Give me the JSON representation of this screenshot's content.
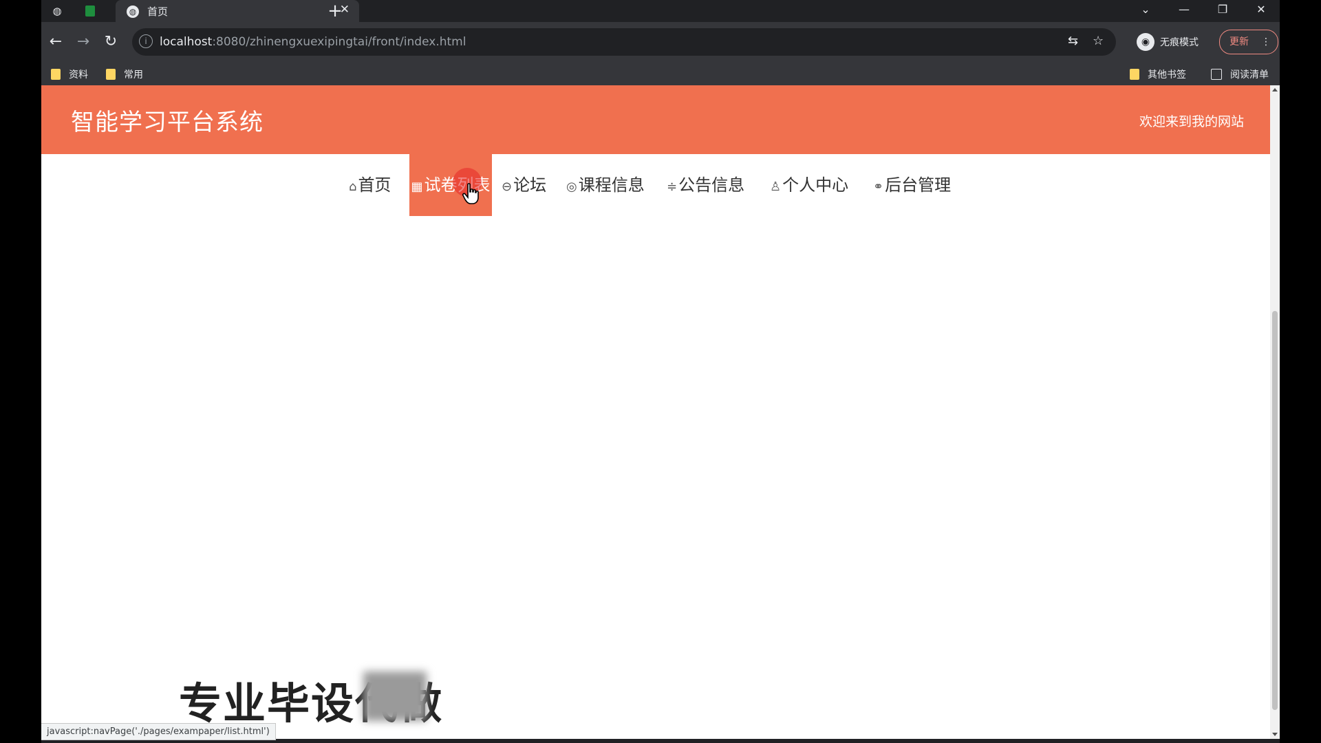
{
  "browser": {
    "tab": {
      "title": "首页"
    },
    "address_bar": {
      "host": "localhost",
      "path": ":8080/zhinengxuexipingtai/front/index.html"
    },
    "profile": {
      "label": "无痕模式"
    },
    "update_button": {
      "label": "更新"
    },
    "bookmarks": {
      "left": [
        {
          "label": "资料"
        },
        {
          "label": "常用"
        }
      ],
      "other_label": "其他书签",
      "reading_list_label": "阅读清单"
    },
    "status_url": "javascript:navPage('./pages/exampaper/list.html')",
    "icons": {
      "favicon": "globe-icon",
      "back": "arrow-left-icon",
      "forward": "arrow-right-icon",
      "reload": "reload-icon",
      "site_info": "info-icon",
      "translate": "translate-icon",
      "bookmark": "star-icon",
      "tab_close": "close-icon",
      "new_tab": "plus-icon"
    }
  },
  "site": {
    "title": "智能学习平台系统",
    "welcome": "欢迎来到我的网站",
    "theme_color": "#f0704f",
    "nav": [
      {
        "label": "首页",
        "icon": "home-icon"
      },
      {
        "label": "试卷列表",
        "icon": "exam-icon",
        "active": true
      },
      {
        "label": "论坛",
        "icon": "forum-icon"
      },
      {
        "label": "课程信息",
        "icon": "course-icon"
      },
      {
        "label": "公告信息",
        "icon": "notice-icon"
      },
      {
        "label": "个人中心",
        "icon": "user-icon"
      },
      {
        "label": "后台管理",
        "icon": "link-icon"
      }
    ]
  },
  "overlay": {
    "caption": "专业毕设代做"
  }
}
